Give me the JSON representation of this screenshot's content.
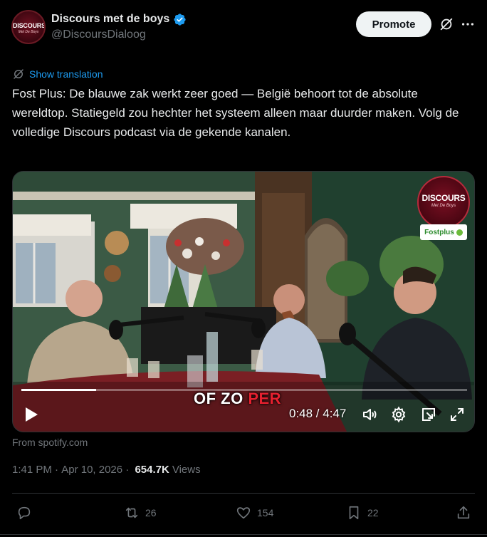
{
  "header": {
    "display_name": "Discours met de boys",
    "handle": "@DiscoursDialoog",
    "avatar_text": "DISCOURS",
    "avatar_subtext": "Met De Boys",
    "promote_label": "Promote",
    "verified": true
  },
  "translation": {
    "label": "Show translation"
  },
  "tweet": {
    "text": "Fost Plus: De blauwe zak werkt zeer goed — België behoort tot de absolute wereldtop. Statiegeld zou hechter het systeem alleen maar duurder maken. Volg de volledige Discours podcast via de gekende kanalen."
  },
  "media": {
    "logo_text": "DISCOURS",
    "logo_subtext": "Met De Boys",
    "sponsor_text": "Fostplus",
    "subtitle_white": "OF ZO ",
    "subtitle_red": "PER",
    "current_time": "0:48",
    "duration": "4:47",
    "time_display": "0:48 / 4:47",
    "progress_fraction": 0.167,
    "source": "From spotify.com"
  },
  "meta": {
    "time": "1:41 PM",
    "separator": " · ",
    "date": "Apr 10, 2026",
    "separator2": " · ",
    "views_count": "654.7K",
    "views_label": "Views"
  },
  "actions": {
    "reposts": "26",
    "likes": "154",
    "bookmarks": "22"
  },
  "colors": {
    "accent": "#1d9bf0",
    "secondary_text": "#71767b",
    "primary_text": "#e7e9ea",
    "background": "#000000"
  }
}
